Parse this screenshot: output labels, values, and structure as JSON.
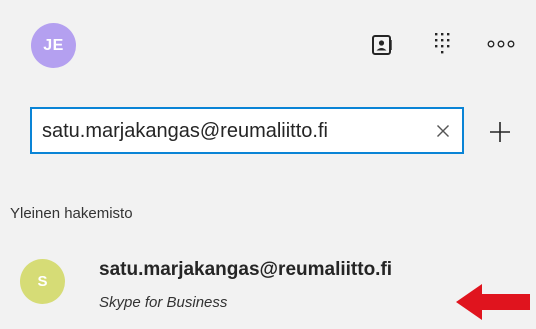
{
  "header": {
    "user_initials": "JE",
    "user_avatar_color": "#b4a0f0",
    "icons": {
      "contacts": "contact-card-icon",
      "apps": "dial-pad-icon",
      "more": "more-options-icon"
    }
  },
  "search": {
    "value": "satu.marjakangas@reumaliitto.fi",
    "border_color": "#0a84d6",
    "clear_icon": "close-icon",
    "add_icon": "plus-icon"
  },
  "directory": {
    "section_label": "Yleinen hakemisto",
    "results": [
      {
        "initial": "S",
        "avatar_color": "#d6dc76",
        "name": "satu.marjakangas@reumaliitto.fi",
        "subtitle": "Skype for Business"
      }
    ]
  },
  "annotation": {
    "arrow_color": "#e0141e",
    "arrow_icon": "red-arrow-pointer"
  }
}
